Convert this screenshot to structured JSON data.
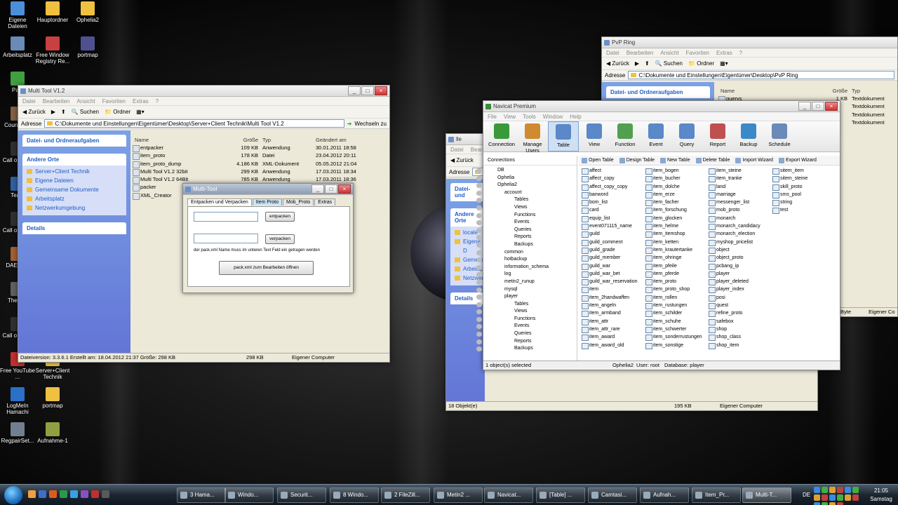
{
  "desktop": {
    "icons": [
      {
        "label": "Eigene Dateien",
        "color": "#4a8fd8"
      },
      {
        "label": "Hauptordner",
        "color": "#f0c040"
      },
      {
        "label": "Ophelia2",
        "color": "#f0c040"
      },
      {
        "label": "Arbeitsplatz",
        "color": "#6a8ab8"
      },
      {
        "label": "Free Window Registry Re...",
        "color": "#c84040"
      },
      {
        "label": "portmap",
        "color": "#505090"
      },
      {
        "label": "Papi",
        "color": "#40a040"
      },
      {
        "label": "Count Sou",
        "color": "#806040"
      },
      {
        "label": "Call o Black",
        "color": "#303030"
      },
      {
        "label": "Team",
        "color": "#3060a0"
      },
      {
        "label": "Call o Black",
        "color": "#303030"
      },
      {
        "label": "DAE Tool",
        "color": "#a06030"
      },
      {
        "label": "The Scr",
        "color": "#606060"
      },
      {
        "label": "Call o Mode",
        "color": "#303030"
      },
      {
        "label": "Free YouTube ...",
        "color": "#c03030"
      },
      {
        "label": "Server+Client Technik",
        "color": "#f0c040"
      },
      {
        "label": "LogMeIn Hamachi",
        "color": "#2a70c8"
      },
      {
        "label": "portmap",
        "color": "#f0c040"
      },
      {
        "label": "RegpairSet...",
        "color": "#708090"
      },
      {
        "label": "Aufnahme-1",
        "color": "#90a040"
      }
    ]
  },
  "pvp": {
    "title": "PvP Ring",
    "menu": [
      "Datei",
      "Bearbeiten",
      "Ansicht",
      "Favoriten",
      "Extras",
      "?"
    ],
    "back": "Zurück",
    "search": "Suchen",
    "folders": "Ordner",
    "address_label": "Adresse",
    "address": "C:\\Dokumente und Einstellungen\\Eigentümer\\Desktop\\PvP Ring",
    "pane_title": "Datei- und Ordneraufgaben",
    "col_name": "Name",
    "col_size": "Größe",
    "col_type": "Typ",
    "files": [
      {
        "name": "querys",
        "size": "1 KB",
        "type": "Textdokument"
      },
      {
        "name": "",
        "size": "",
        "type": "Textdokument"
      },
      {
        "name": "",
        "size": "",
        "type": "Textdokument"
      },
      {
        "name": "",
        "size": "",
        "type": "Textdokument"
      }
    ],
    "status_size": "Byte",
    "status_loc": "Eigener Co"
  },
  "mid": {
    "title": "lle",
    "menu": [
      "Datei",
      "Bearbeiten"
    ],
    "back": "Zurück",
    "address_label": "Adresse",
    "pane_title": "Datei- und",
    "other_places": "Andere Orte",
    "places": [
      "locale",
      "Eigene D",
      "Gemeinsam",
      "Arbeitsp",
      "Netzwer"
    ],
    "details": "Details",
    "status_count": "18 Objekt(e)",
    "status_size": "195 KB",
    "status_loc": "Eigener Computer"
  },
  "mt": {
    "title": "Multi Tool V1.2",
    "menu": [
      "Datei",
      "Bearbeiten",
      "Ansicht",
      "Favoriten",
      "Extras",
      "?"
    ],
    "back": "Zurück",
    "search": "Suchen",
    "folders": "Ordner",
    "address_label": "Adresse",
    "address": "C:\\Dokumente und Einstellungen\\Eigentümer\\Desktop\\Server+Client Technik\\Multi Tool V1.2",
    "go": "Wechseln zu",
    "pane_title": "Datei- und Ordneraufgaben",
    "other_places": "Andere Orte",
    "places": [
      "Server+Client Technik",
      "Eigene Dateien",
      "Gemeinsame Dokumente",
      "Arbeitsplatz",
      "Netzwerkumgebung"
    ],
    "details": "Details",
    "col_name": "Name",
    "col_size": "Größe",
    "col_type": "Typ",
    "col_date": "Geändert am",
    "files": [
      {
        "name": "entpacker",
        "size": "109 KB",
        "type": "Anwendung",
        "date": "30.01.2011 18:58"
      },
      {
        "name": "item_proto",
        "size": "178 KB",
        "type": "Datei",
        "date": "23.04.2012 20:11"
      },
      {
        "name": "item_proto_dump",
        "size": "4.186 KB",
        "type": "XML-Dokument",
        "date": "05.05.2012 21:04"
      },
      {
        "name": "Multi Tool V1.2 32bit",
        "size": "299 KB",
        "type": "Anwendung",
        "date": "17.03.2011 18:34"
      },
      {
        "name": "Multi Tool V1.2 64Bit",
        "size": "785 KB",
        "type": "Anwendung",
        "date": "17.03.2011 18:36"
      },
      {
        "name": "packer",
        "size": "",
        "type": "",
        "date": ""
      },
      {
        "name": "XML_Creator",
        "size": "",
        "type": "",
        "date": ""
      }
    ],
    "status_info": "Dateiversion: 3.3.6.1 Erstellt am: 18.04.2012 21:37 Größe: 298 KB",
    "status_size": "298 KB",
    "status_loc": "Eigener Computer"
  },
  "dlg": {
    "title": "Multi-Tool",
    "tabs": [
      "Entpacken und Verpacken",
      "Item Proto",
      "Mob_Proto",
      "Extras"
    ],
    "btn_unpack": "entpacken",
    "btn_pack": "verpacken",
    "hint": "der pack.xml Name muss im unteren Text Feld ein getragen werden",
    "btn_open": "pack.xml zum Bearbeiten öffnen",
    "input1": "",
    "input2": ""
  },
  "nav": {
    "title": "Navicat Premium",
    "menu": [
      "File",
      "View",
      "Tools",
      "Window",
      "Help"
    ],
    "toolbar": [
      "Connection",
      "Manage Users",
      "Table",
      "View",
      "Function",
      "Event",
      "Query",
      "Report",
      "Backup",
      "Schedule"
    ],
    "toolbar_colors": [
      "#3a9a3a",
      "#d08a30",
      "#5a88c8",
      "#5a88c8",
      "#50a050",
      "#5a88c8",
      "#5a88c8",
      "#c05050",
      "#3a8ac8",
      "#6a8ab8"
    ],
    "connections": "Connections",
    "tree": [
      "DB",
      "Ophelia",
      "Ophelia2",
      "account",
      "Tables",
      "Views",
      "Functions",
      "Events",
      "Queries",
      "Reports",
      "Backups",
      "common",
      "hotbackup",
      "information_schema",
      "log",
      "metin2_runup",
      "mysql",
      "player",
      "Tables",
      "Views",
      "Functions",
      "Events",
      "Queries",
      "Reports",
      "Backups"
    ],
    "ops": [
      "Open Table",
      "Design Table",
      "New Table",
      "Delete Table",
      "Import Wizard",
      "Export Wizard"
    ],
    "tables": [
      [
        "affect",
        "affect_copy",
        "affect_copy_copy",
        "banword",
        "bom_list",
        "card",
        "equip_list",
        "event071115_name",
        "guild",
        "guild_comment",
        "guild_grade",
        "guild_member",
        "guild_war",
        "guild_war_bet",
        "guild_war_reservation",
        "item",
        "item_2handwaffen",
        "item_angeln",
        "item_armband",
        "item_attr",
        "item_attr_rare",
        "item_award",
        "item_award_old"
      ],
      [
        "item_bogen",
        "item_bucher",
        "item_dolche",
        "item_erze",
        "item_facher",
        "item_forschung",
        "item_glocken",
        "item_helme",
        "item_itemshop",
        "item_ketten",
        "item_krautertanke",
        "item_ohringe",
        "item_pfeile",
        "item_pferde",
        "item_proto",
        "item_proto_shop",
        "item_rollen",
        "item_rustungen",
        "item_schilder",
        "item_schuhe",
        "item_schwerter",
        "item_sonderrustungen",
        "item_sonstige"
      ],
      [
        "item_steine",
        "item_tranke",
        "land",
        "marriage",
        "messenger_list",
        "mob_proto",
        "monarch",
        "monarch_candidacy",
        "monarch_election",
        "myshop_pricelist",
        "object",
        "object_proto",
        "pcbang_ip",
        "player",
        "player_deleted",
        "player_index",
        "posi",
        "quest",
        "refine_proto",
        "safebox",
        "shop",
        "shop_class",
        "shop_item"
      ],
      [
        "sitem_item",
        "sitem_steine",
        "skill_proto",
        "sms_pool",
        "string",
        "test"
      ]
    ],
    "status_sel": "1 object(s) selected",
    "status_db": "Ophelia2",
    "status_user": "User: root",
    "status_dbname": "Database: player"
  },
  "taskbar": {
    "items": [
      "3 Hama...",
      "Windo...",
      "Securit...",
      "8 Windo...",
      "2 FileZill...",
      "Metin2 ...",
      "Navicat...",
      "[Table] ...",
      "Camtasi...",
      "Aufnah...",
      "Item_Pr...",
      "Multi-T..."
    ],
    "active_index": 11,
    "lang": "DE",
    "time": "21:05",
    "day": "Samstag"
  }
}
